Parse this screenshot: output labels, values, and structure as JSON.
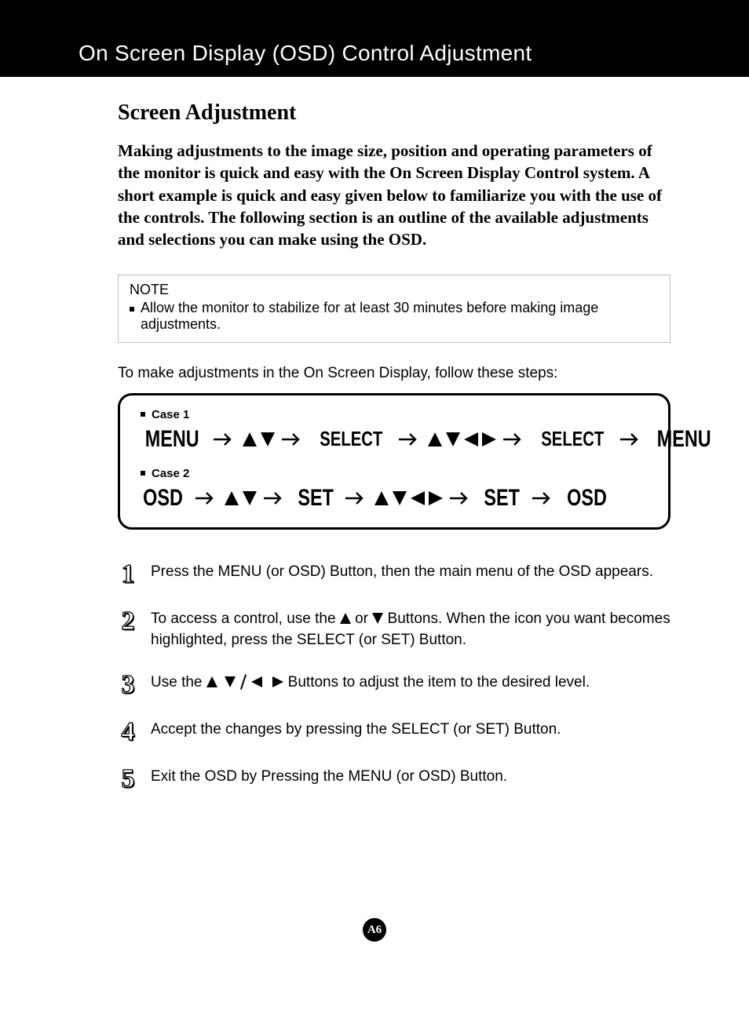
{
  "header": {
    "title": "On Screen Display (OSD) Control Adjustment"
  },
  "section": {
    "heading": "Screen Adjustment"
  },
  "intro": "Making adjustments to the image size, position and operating parameters of the monitor is quick and easy with the On Screen Display Control system. A short example is quick and easy given below to familiarize you with the use of the controls. The following section is an outline of the available adjustments and selections you can make using the OSD.",
  "note": {
    "title": "NOTE",
    "text": "Allow the monitor to stabilize for at least 30 minutes before making image adjustments."
  },
  "lead": "To make adjustments in the On Screen Display, follow these steps:",
  "cases": {
    "case1": {
      "label": "Case 1",
      "t1": "MENU",
      "t2": "SELECT",
      "t3": "SELECT",
      "t4": "MENU"
    },
    "case2": {
      "label": "Case 2",
      "t1": "OSD",
      "t2": "SET",
      "t3": "SET",
      "t4": "OSD"
    }
  },
  "steps": {
    "s1": {
      "n": "1",
      "a": "Press the ",
      "b": "MENU (or OSD) Button",
      "c": ", then the main menu of the OSD appears."
    },
    "s2": {
      "n": "2",
      "a": "To access a control, use the ",
      "mid": " or ",
      "b": " Buttons",
      "c": ". When the icon you want becomes highlighted, press the ",
      "d": "SELECT (or SET) Button",
      "e": "."
    },
    "s3": {
      "n": "3",
      "a": "Use the ",
      "b": " Buttons",
      "c": " to adjust the item to the desired level."
    },
    "s4": {
      "n": "4",
      "a": "Accept the changes by pressing the ",
      "b": "SELECT (or SET) Button",
      "c": "."
    },
    "s5": {
      "n": "5",
      "a": "Exit the OSD by Pressing the ",
      "b": "MENU  (or OSD) Button",
      "c": "."
    }
  },
  "page_number": "A6"
}
